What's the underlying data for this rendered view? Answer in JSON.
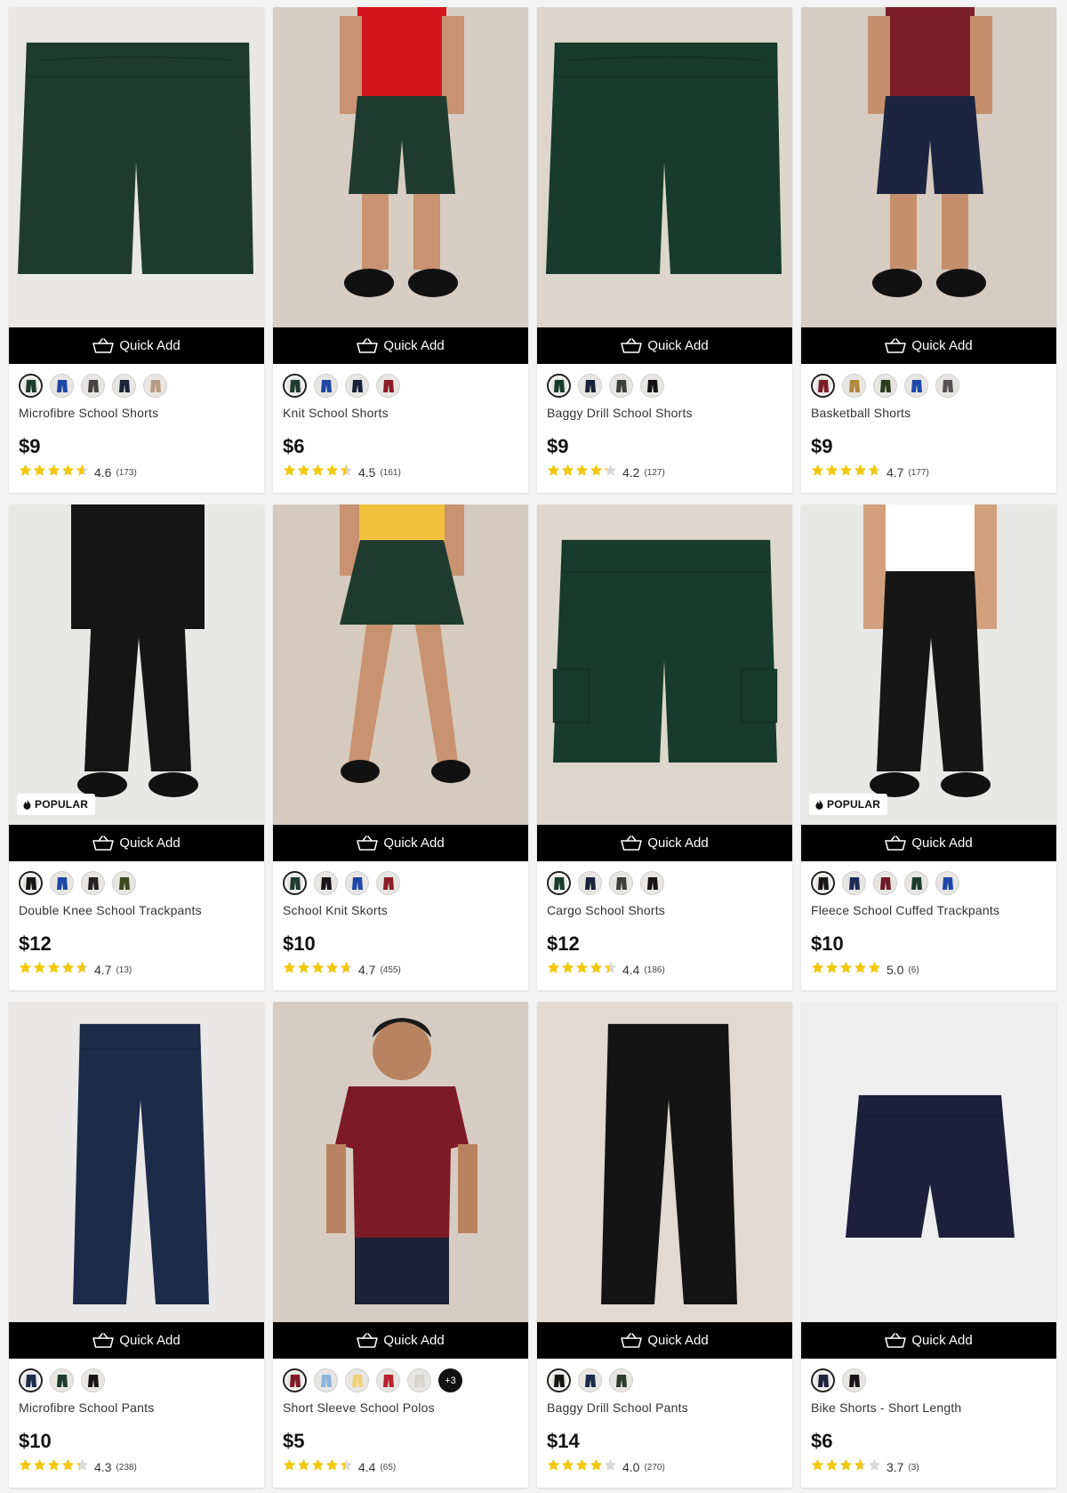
{
  "ui": {
    "quick_add_label": "Quick Add",
    "popular_label": "POPULAR",
    "star_color": "#f2c80f",
    "star_empty_color": "#d9d9d9"
  },
  "products": [
    {
      "name": "Microfibre School Shorts",
      "price": "$9",
      "rating": 4.6,
      "rating_text": "4.6",
      "reviews": "(173)",
      "badge": "",
      "photo": {
        "bg": "#e9e8e6",
        "item": "shorts-flat",
        "color": "#1f3b2f"
      },
      "swatches": [
        "#1f3b2f",
        "#1f47a8",
        "#444444",
        "#1b2238",
        "#b79d86"
      ],
      "more": ""
    },
    {
      "name": "Knit School Shorts",
      "price": "$6",
      "rating": 4.5,
      "rating_text": "4.5",
      "reviews": "(161)",
      "badge": "",
      "photo": {
        "bg": "#d7cdc3",
        "item": "model-shorts",
        "color": "#1f3b2f",
        "top": "#d3161c",
        "skin": "#c99270"
      },
      "swatches": [
        "#1f3b2f",
        "#1f47a8",
        "#1b2238",
        "#8c1c27"
      ],
      "more": ""
    },
    {
      "name": "Baggy Drill School Shorts",
      "price": "$9",
      "rating": 4.2,
      "rating_text": "4.2",
      "reviews": "(127)",
      "badge": "",
      "photo": {
        "bg": "#ddd6cd",
        "item": "shorts-flat",
        "color": "#173b2c"
      },
      "swatches": [
        "#173b2c",
        "#1b2238",
        "#3b3f3a",
        "#141414"
      ],
      "more": ""
    },
    {
      "name": "Basketball Shorts",
      "price": "$9",
      "rating": 4.7,
      "rating_text": "4.7",
      "reviews": "(177)",
      "badge": "",
      "photo": {
        "bg": "#d6ccc1",
        "item": "model-shorts",
        "color": "#1c2540",
        "top": "#7c1e2a",
        "skin": "#c58f6c"
      },
      "swatches": [
        "#7c1e2a",
        "#b2873d",
        "#2e3b1f",
        "#1f47a8",
        "#555555"
      ],
      "more": ""
    },
    {
      "name": "Double Knee School Trackpants",
      "price": "$12",
      "rating": 4.7,
      "rating_text": "4.7",
      "reviews": "(13)",
      "badge": "popular",
      "photo": {
        "bg": "#e8e8e7",
        "item": "model-pants",
        "color": "#151515",
        "top": "#151515",
        "skin": "#c99270"
      },
      "swatches": [
        "#151515",
        "#1f47a8",
        "#222222",
        "#3c4a20"
      ],
      "more": ""
    },
    {
      "name": "School Knit Skorts",
      "price": "$10",
      "rating": 4.7,
      "rating_text": "4.7",
      "reviews": "(455)",
      "badge": "",
      "photo": {
        "bg": "#d5cabd",
        "item": "model-skort",
        "color": "#1f3b2f",
        "top": "#efc13c",
        "skin": "#c99270"
      },
      "swatches": [
        "#1f3b2f",
        "#151515",
        "#1f47a8",
        "#8c1c27"
      ],
      "more": ""
    },
    {
      "name": "Cargo School Shorts",
      "price": "$12",
      "rating": 4.4,
      "rating_text": "4.4",
      "reviews": "(186)",
      "badge": "",
      "photo": {
        "bg": "#ddd7ce",
        "item": "shorts-cargo",
        "color": "#173b2c"
      },
      "swatches": [
        "#173b2c",
        "#1b2238",
        "#3b3f3a",
        "#141414"
      ],
      "more": ""
    },
    {
      "name": "Fleece School Cuffed Trackpants",
      "price": "$10",
      "rating": 5.0,
      "rating_text": "5.0",
      "reviews": "(6)",
      "badge": "popular",
      "photo": {
        "bg": "#e8e8e7",
        "item": "model-pants",
        "color": "#161616",
        "top": "#ffffff",
        "skin": "#d2a07c"
      },
      "swatches": [
        "#161616",
        "#1b2b55",
        "#6e1b2b",
        "#1f3b2f",
        "#1f47a8"
      ],
      "more": ""
    },
    {
      "name": "Microfibre School Pants",
      "price": "$10",
      "rating": 4.3,
      "rating_text": "4.3",
      "reviews": "(238)",
      "badge": "",
      "photo": {
        "bg": "#e9e8e6",
        "item": "pants-flat",
        "color": "#1c2b4a"
      },
      "swatches": [
        "#1c2b4a",
        "#1f3b2f",
        "#151515"
      ],
      "more": ""
    },
    {
      "name": "Short Sleeve School Polos",
      "price": "$5",
      "rating": 4.4,
      "rating_text": "4.4",
      "reviews": "(65)",
      "badge": "",
      "photo": {
        "bg": "#d7ccc1",
        "item": "model-polo",
        "color": "#1b2238",
        "top": "#7d1a27",
        "skin": "#b98360"
      },
      "swatches": [
        "#7d1a27",
        "#8fb3d9",
        "#f0d279",
        "#b8232c",
        "#d6d2cc"
      ],
      "more": "+3"
    },
    {
      "name": "Baggy Drill School Pants",
      "price": "$14",
      "rating": 4.0,
      "rating_text": "4.0",
      "reviews": "(270)",
      "badge": "",
      "photo": {
        "bg": "#e0dad2",
        "item": "pants-flat",
        "color": "#141414"
      },
      "swatches": [
        "#141414",
        "#1c2b4a",
        "#2e3a2e"
      ],
      "more": ""
    },
    {
      "name": "Bike Shorts - Short Length",
      "price": "$6",
      "rating": 3.7,
      "rating_text": "3.7",
      "reviews": "(3)",
      "badge": "",
      "photo": {
        "bg": "#eeeeee",
        "item": "bike-shorts",
        "color": "#1d1f3b"
      },
      "swatches": [
        "#1d1f3b",
        "#151515"
      ],
      "more": ""
    }
  ]
}
